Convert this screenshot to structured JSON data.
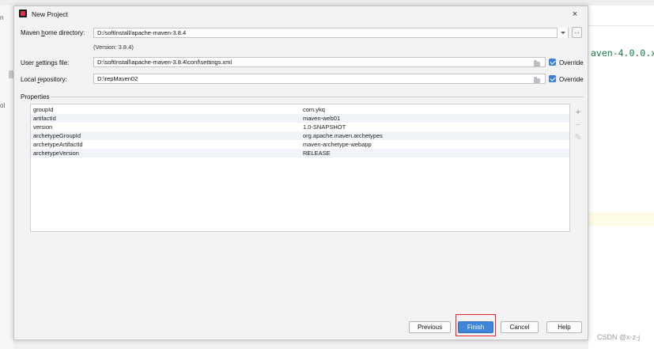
{
  "background": {
    "code_snippet": "aven-4.0.0.x",
    "left_letters": [
      "n",
      "ol"
    ],
    "watermark": "CSDN @x-z-j"
  },
  "dialog": {
    "title": "New Project",
    "close_glyph": "×",
    "maven_home": {
      "label": "Maven home directory:",
      "value": "D:/softInstall/apache-maven-3.8.4",
      "version": "(Version: 3.8.4)",
      "browse_label": "..."
    },
    "user_settings": {
      "label": "User settings file:",
      "value": "D:\\softInstall\\apache-maven-3.8.4\\conf\\settings.xml",
      "override_label": "Override",
      "override_checked": true
    },
    "local_repo": {
      "label": "Local repository:",
      "value": "D:\\repMaven02",
      "override_label": "Override",
      "override_checked": true
    },
    "properties": {
      "title": "Properties",
      "rows": [
        {
          "name": "groupId",
          "value": "com.ykq"
        },
        {
          "name": "artifactId",
          "value": "maven-web01"
        },
        {
          "name": "version",
          "value": "1.0-SNAPSHOT"
        },
        {
          "name": "archetypeGroupId",
          "value": "org.apache.maven.archetypes"
        },
        {
          "name": "archetypeArtifactId",
          "value": "maven-archetype-webapp"
        },
        {
          "name": "archetypeVersion",
          "value": "RELEASE"
        }
      ],
      "tools": {
        "add": "+",
        "remove": "−",
        "edit": "✎"
      }
    },
    "buttons": {
      "previous": "Previous",
      "finish": "Finish",
      "cancel": "Cancel",
      "help": "Help"
    }
  },
  "colors": {
    "accent": "#3f86d8",
    "highlight_box": "#e0262c",
    "code_green": "#167e43"
  },
  "icons": [
    "app-logo-icon",
    "close-icon",
    "chevron-down-icon",
    "folder-icon",
    "checkbox-icon",
    "plus-icon",
    "minus-icon",
    "pencil-icon"
  ]
}
